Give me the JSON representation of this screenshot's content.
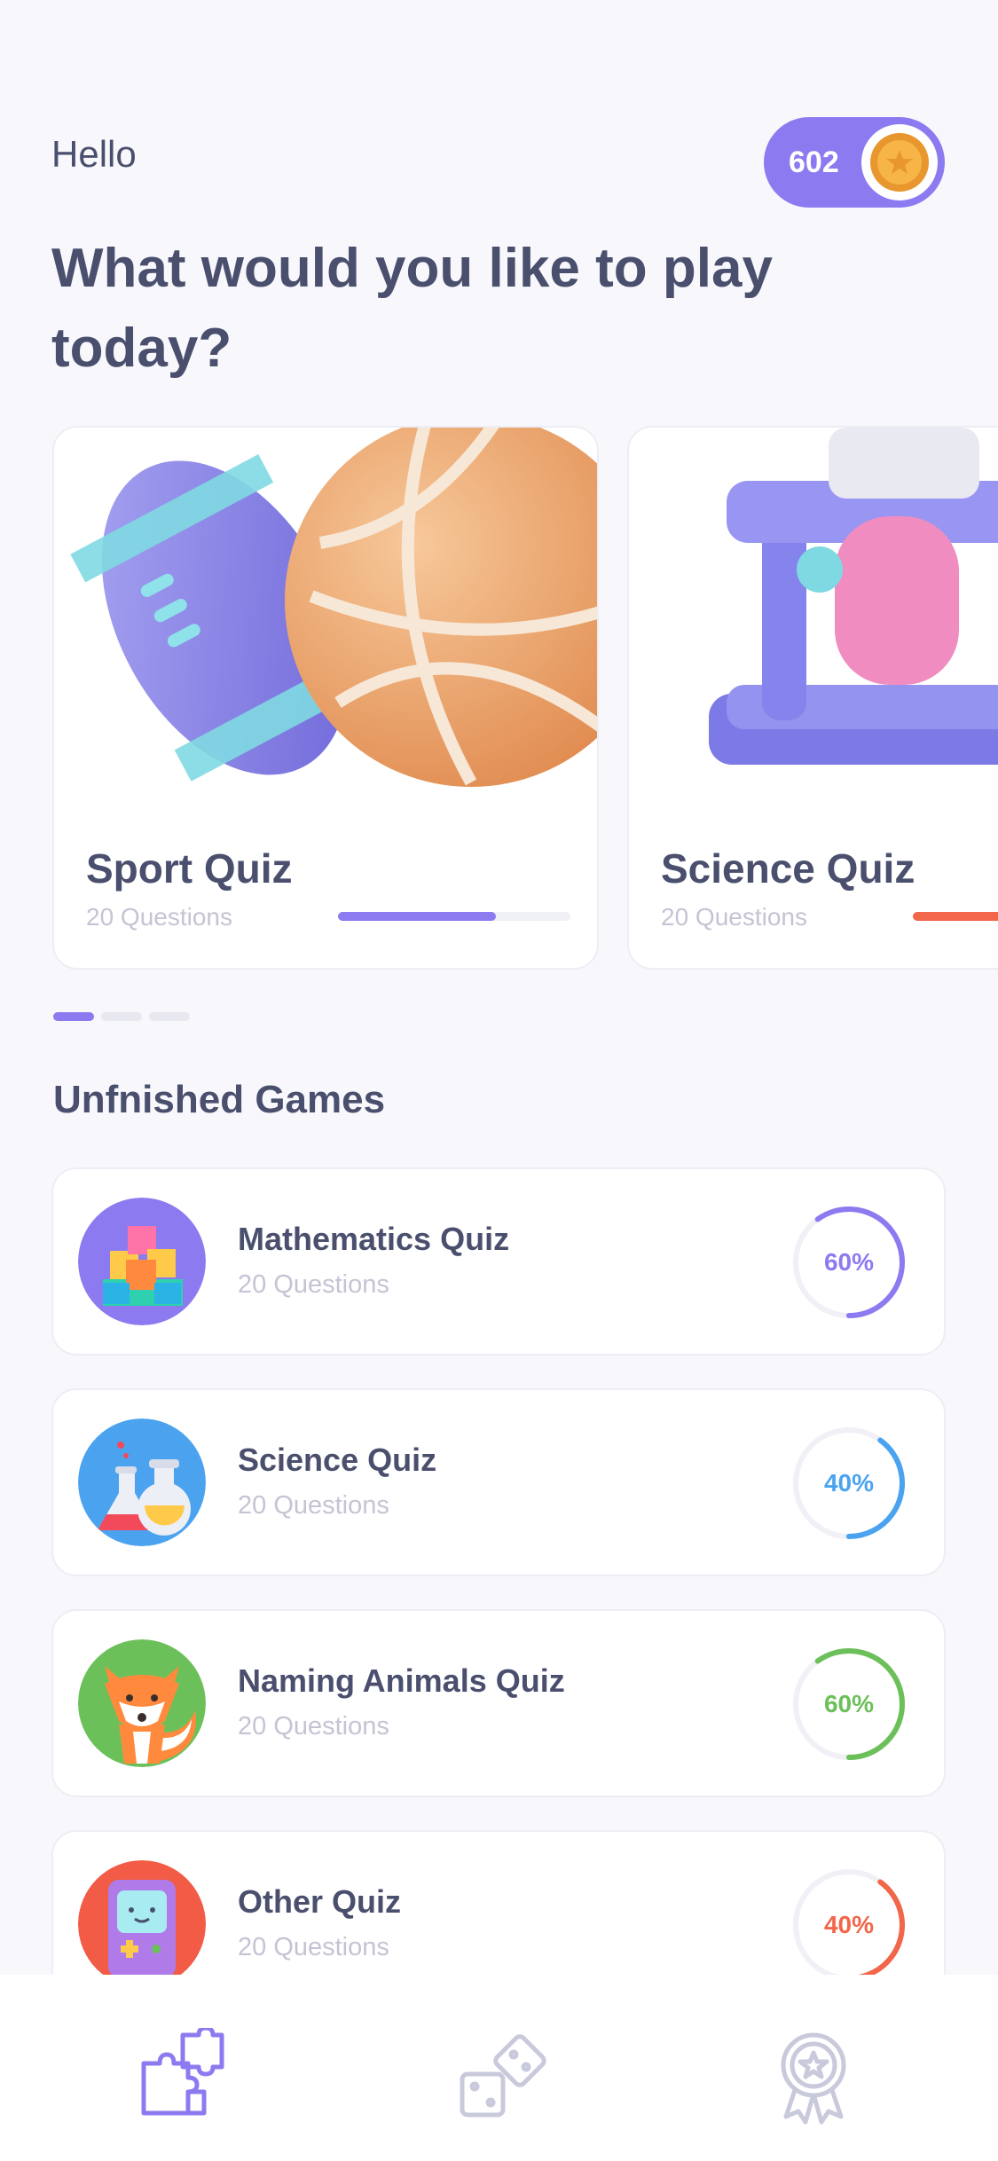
{
  "header": {
    "greeting": "Hello",
    "coins": "602",
    "headline": "What would you like to play today?"
  },
  "featured": [
    {
      "title": "Sport Quiz",
      "questions": "20 Questions",
      "progress": 0.68,
      "color": "#8C7BF0",
      "icon": "sports-balls-icon"
    },
    {
      "title": "Science Quiz",
      "questions": "20 Questions",
      "progress": 0.4,
      "color": "#F2664A",
      "icon": "test-tubes-icon"
    }
  ],
  "carousel_page": {
    "current": 1,
    "total": 3
  },
  "unfinished": {
    "title": "Unfnished Games",
    "items": [
      {
        "title": "Mathematics Quiz",
        "questions": "20 Questions",
        "percent": "60%",
        "progress": 0.6,
        "color": "#8C7BF0",
        "icon": "cubes-icon"
      },
      {
        "title": "Science Quiz",
        "questions": "20 Questions",
        "percent": "40%",
        "progress": 0.4,
        "color": "#4BA3F0",
        "icon": "flasks-icon"
      },
      {
        "title": "Naming Animals Quiz",
        "questions": "20 Questions",
        "percent": "60%",
        "progress": 0.6,
        "color": "#6CC05A",
        "icon": "fox-icon"
      },
      {
        "title": "Other Quiz",
        "questions": "20 Questions",
        "percent": "40%",
        "progress": 0.4,
        "color": "#F2664A",
        "icon": "game-console-icon"
      }
    ]
  },
  "tabbar": {
    "items": [
      {
        "name": "puzzle-tab",
        "icon": "puzzle-icon",
        "active": true
      },
      {
        "name": "dice-tab",
        "icon": "dice-icon",
        "active": false
      },
      {
        "name": "award-tab",
        "icon": "award-icon",
        "active": false
      }
    ],
    "active_color": "#8C7BF0",
    "inactive_color": "#C9C9DC"
  }
}
